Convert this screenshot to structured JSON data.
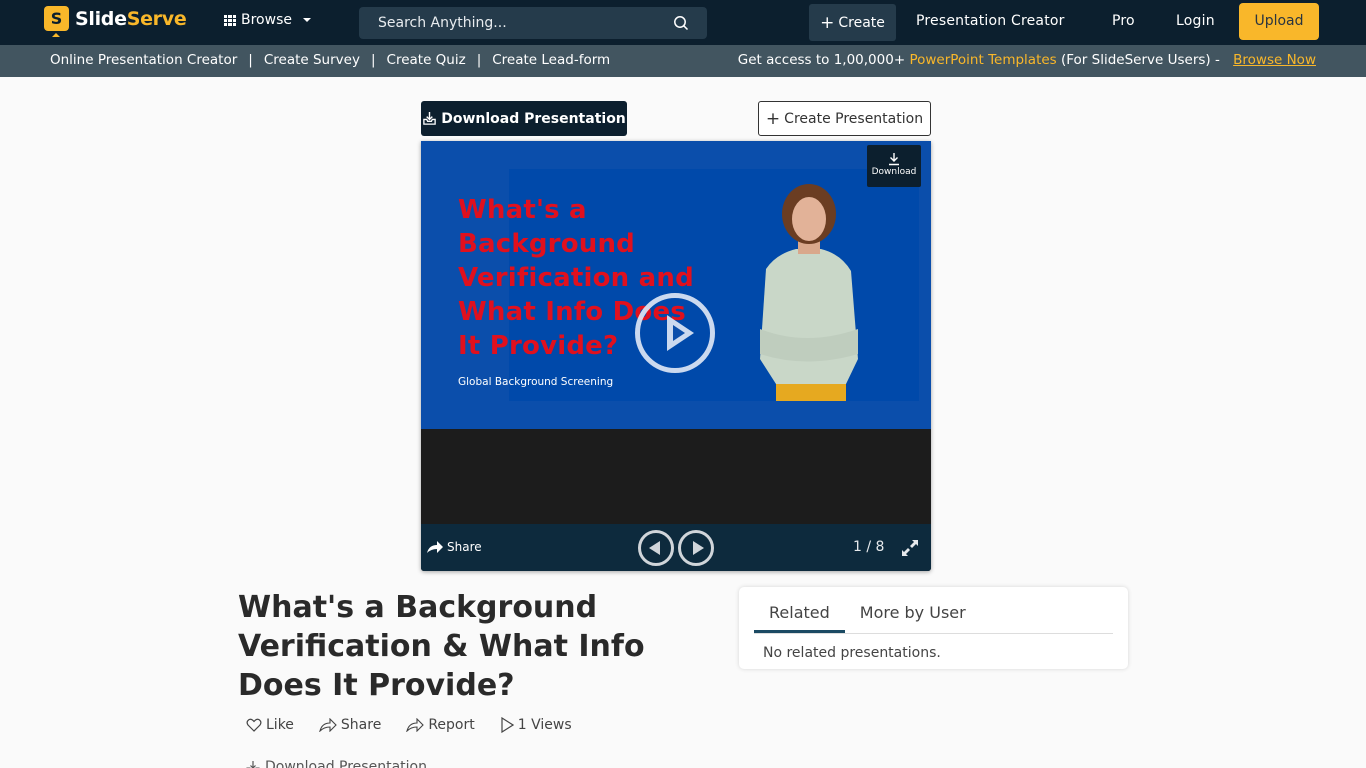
{
  "nav": {
    "logo_left": "Slide",
    "logo_right": "Serve",
    "logo_badge": "S",
    "browse_label": "Browse",
    "search_placeholder": "Search Anything...",
    "create_label": "Create",
    "links": [
      "Presentation Creator",
      "Pro",
      "Login"
    ],
    "upload_label": "Upload"
  },
  "subnav": {
    "links": [
      "Online Presentation Creator",
      "Create Survey",
      "Create Quiz",
      "Create Lead-form"
    ],
    "separator": "|",
    "promo_prefix": "Get access to 1,00,000+ ",
    "promo_highlight": "PowerPoint Templates",
    "promo_suffix": " (For SlideServe Users) - ",
    "browse_now": "Browse Now"
  },
  "buttons": {
    "download_presentation": "Download Presentation",
    "create_presentation": "Create Presentation"
  },
  "slide": {
    "title": "What's a Background Verification and What Info Does It Provide?",
    "subtitle": "Global Background Screening",
    "download_label": "Download",
    "share_label": "Share",
    "current_page": 1,
    "total_pages": 8,
    "page_counter": "1 / 8"
  },
  "main": {
    "title": "What's a Background Verification & What Info Does It Provide?",
    "actions": {
      "like": "Like",
      "share": "Share",
      "report": "Report",
      "views": "1 Views"
    },
    "download_link": "Download Presentation"
  },
  "related": {
    "tabs": [
      "Related",
      "More by User"
    ],
    "active_tab": "Related",
    "empty_text": "No related presentations."
  },
  "colors": {
    "nav_bg": "#0c1f2e",
    "subnav_bg": "#425560",
    "accent": "#f9b72a",
    "slide_bg": "#0b4eab",
    "slide_title": "#e0101e"
  }
}
